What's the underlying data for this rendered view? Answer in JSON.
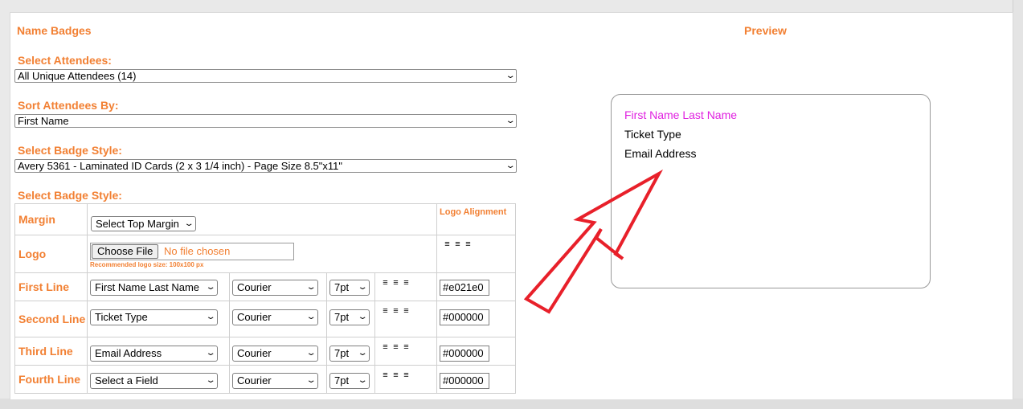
{
  "header": {
    "title": "Name Badges",
    "preview_title": "Preview"
  },
  "attendees": {
    "label": "Select Attendees:",
    "value": "All Unique Attendees (14)"
  },
  "sort": {
    "label": "Sort Attendees By:",
    "value": "First Name"
  },
  "badge_style": {
    "label": "Select Badge Style:",
    "value": "Avery 5361 - Laminated ID Cards (2 x 3 1/4 inch) - Page Size 8.5\"x11\""
  },
  "badge_style2": {
    "label": "Select Badge Style:"
  },
  "grid": {
    "margin_label": "Margin",
    "margin_value": "Select Top Margin",
    "logo_alignment_label": "Logo Alignment",
    "logo_label": "Logo",
    "choose_file": "Choose File",
    "no_file": "No file chosen",
    "recommended": "Recommended logo size: 100x100 px",
    "rows": [
      {
        "label": "First Line",
        "field": "First Name Last Name",
        "font": "Courier",
        "size": "7pt",
        "color": "#e021e0"
      },
      {
        "label": "Second Line",
        "field": "Ticket Type",
        "font": "Courier",
        "size": "7pt",
        "color": "#000000"
      },
      {
        "label": "Third Line",
        "field": "Email Address",
        "font": "Courier",
        "size": "7pt",
        "color": "#000000"
      },
      {
        "label": "Fourth Line",
        "field": "Select a Field",
        "font": "Courier",
        "size": "7pt",
        "color": "#000000"
      }
    ]
  },
  "preview": {
    "line1": "First Name Last Name",
    "line2": "Ticket Type",
    "line3": "Email Address",
    "line1_color": "#e021e0"
  },
  "colors": {
    "accent": "#f28033",
    "arrow": "#e8202a"
  }
}
